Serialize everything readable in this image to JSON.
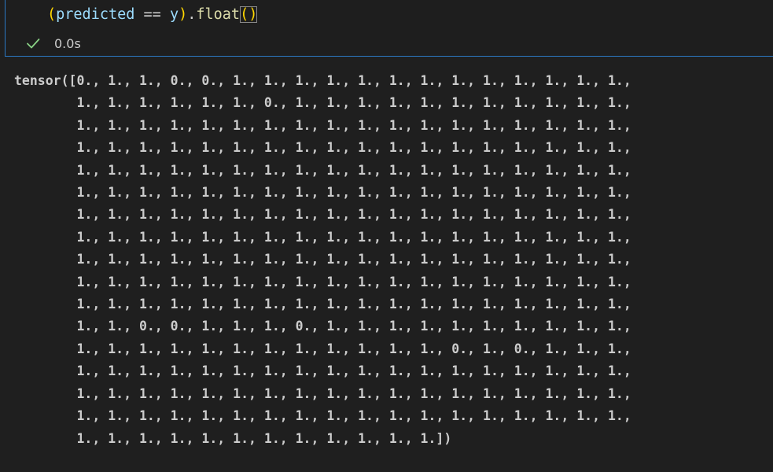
{
  "cell": {
    "code": {
      "open_paren": "(",
      "var_predicted": "predicted",
      "operator": " == ",
      "var_y": "y",
      "close_paren": ")",
      "dot": ".",
      "method": "float",
      "call_parens": "()"
    },
    "status": {
      "icon": "check-icon",
      "time": "0.0s"
    }
  },
  "output": {
    "lines": [
      "tensor([0., 1., 1., 0., 0., 1., 1., 1., 1., 1., 1., 1., 1., 1., 1., 1., 1., 1.,",
      "        1., 1., 1., 1., 1., 1., 0., 1., 1., 1., 1., 1., 1., 1., 1., 1., 1., 1.,",
      "        1., 1., 1., 1., 1., 1., 1., 1., 1., 1., 1., 1., 1., 1., 1., 1., 1., 1.,",
      "        1., 1., 1., 1., 1., 1., 1., 1., 1., 1., 1., 1., 1., 1., 1., 1., 1., 1.,",
      "        1., 1., 1., 1., 1., 1., 1., 1., 1., 1., 1., 1., 1., 1., 1., 1., 1., 1.,",
      "        1., 1., 1., 1., 1., 1., 1., 1., 1., 1., 1., 1., 1., 1., 1., 1., 1., 1.,",
      "        1., 1., 1., 1., 1., 1., 1., 1., 1., 1., 1., 1., 1., 1., 1., 1., 1., 1.,",
      "        1., 1., 1., 1., 1., 1., 1., 1., 1., 1., 1., 1., 1., 1., 1., 1., 1., 1.,",
      "        1., 1., 1., 1., 1., 1., 1., 1., 1., 1., 1., 1., 1., 1., 1., 1., 1., 1.,",
      "        1., 1., 1., 1., 1., 1., 1., 1., 1., 1., 1., 1., 1., 1., 1., 1., 1., 1.,",
      "        1., 1., 1., 1., 1., 1., 1., 1., 1., 1., 1., 1., 1., 1., 1., 1., 1., 1.,",
      "        1., 1., 0., 0., 1., 1., 1., 0., 1., 1., 1., 1., 1., 1., 1., 1., 1., 1.,",
      "        1., 1., 1., 1., 1., 1., 1., 1., 1., 1., 1., 1., 0., 1., 0., 1., 1., 1.,",
      "        1., 1., 1., 1., 1., 1., 1., 1., 1., 1., 1., 1., 1., 1., 1., 1., 1., 1.,",
      "        1., 1., 1., 1., 1., 1., 1., 1., 1., 1., 1., 1., 1., 1., 1., 1., 1., 1.,",
      "        1., 1., 1., 1., 1., 1., 1., 1., 1., 1., 1., 1., 1., 1., 1., 1., 1., 1.,",
      "        1., 1., 1., 1., 1., 1., 1., 1., 1., 1., 1., 1.])"
    ]
  },
  "colors": {
    "background": "#1f1f1f",
    "cell_border": "#2b79c4",
    "bracket": "#ffd700",
    "variable": "#9cdcfe",
    "function": "#dcdcaa",
    "success": "#89d185",
    "text": "#cccccc"
  }
}
